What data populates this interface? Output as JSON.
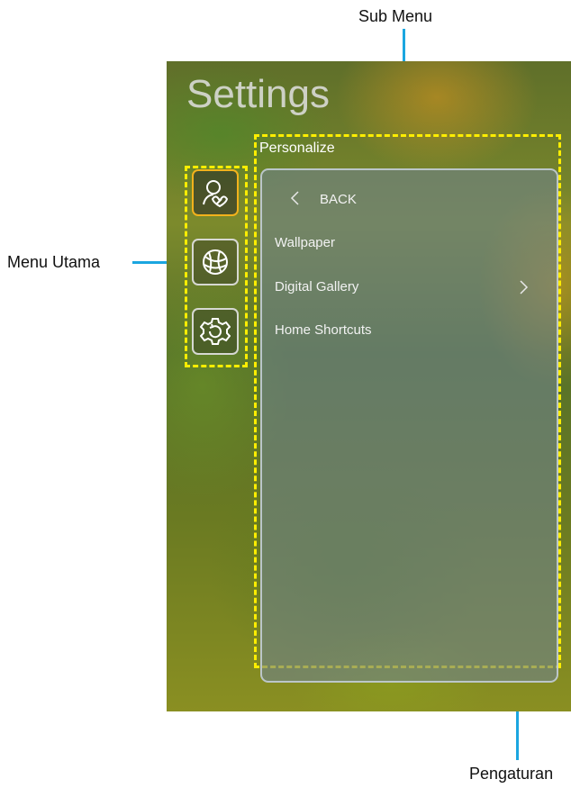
{
  "annotations": {
    "sub_menu": "Sub Menu",
    "menu_utama": "Menu Utama",
    "pengaturan": "Pengaturan",
    "line_color": "#1ba6e0",
    "highlight_color": "#ffee00"
  },
  "screen": {
    "title": "Settings",
    "side_menu": [
      {
        "icon": "user-personalize-icon",
        "active": true
      },
      {
        "icon": "globe-network-icon",
        "active": false
      },
      {
        "icon": "gear-reset-icon",
        "active": false
      }
    ],
    "submenu": {
      "header": "Personalize",
      "back_label": "BACK",
      "items": [
        "Wallpaper",
        "Digital Gallery",
        "Home Shortcuts"
      ]
    },
    "active_accent": "#f2b21c"
  }
}
